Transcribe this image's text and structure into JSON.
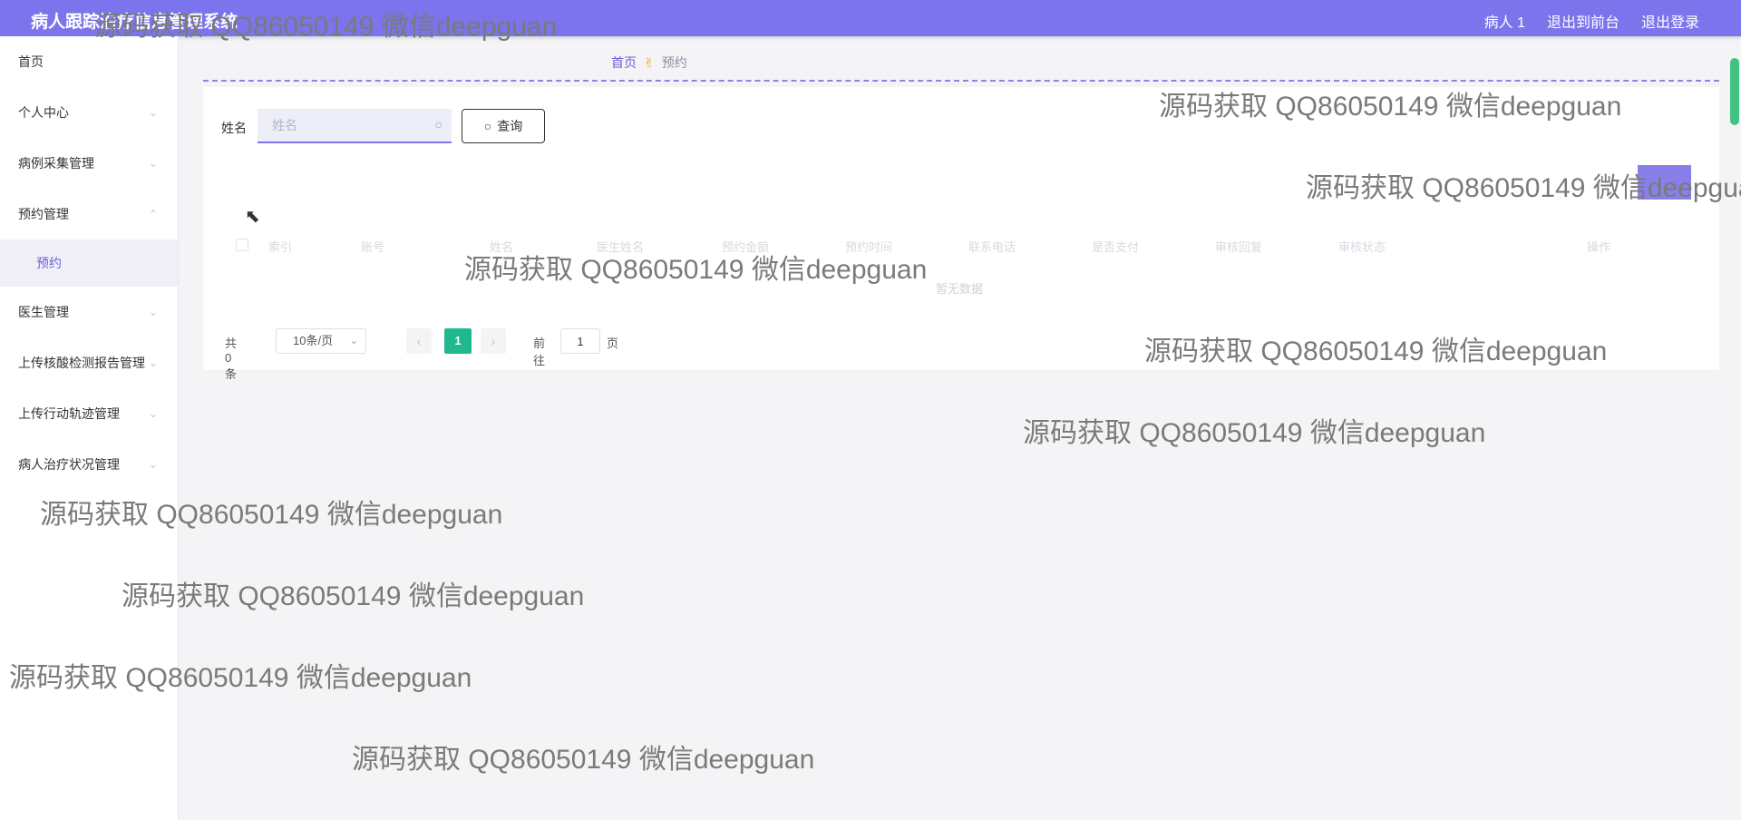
{
  "header": {
    "title": "病人跟踪治疗信息管理系统",
    "links": [
      "病人 1",
      "退出到前台",
      "退出登录"
    ]
  },
  "sidebar": {
    "items": [
      {
        "label": "首页",
        "chevron": ""
      },
      {
        "label": "个人中心",
        "chevron": "⌄"
      },
      {
        "label": "病例采集管理",
        "chevron": "⌄"
      },
      {
        "label": "预约管理",
        "chevron": "⌃"
      },
      {
        "label": "预约",
        "chevron": ""
      },
      {
        "label": "医生管理",
        "chevron": "⌄"
      },
      {
        "label": "上传核酸检测报告管理",
        "chevron": "⌄"
      },
      {
        "label": "上传行动轨迹管理",
        "chevron": "⌄"
      },
      {
        "label": "病人治疗状况管理",
        "chevron": "⌄"
      }
    ]
  },
  "breadcrumb": {
    "home": "首页",
    "current": "预约"
  },
  "search": {
    "label": "姓名",
    "placeholder": "姓名",
    "button": "查询"
  },
  "table": {
    "columns": [
      "索引",
      "账号",
      "姓名",
      "医生姓名",
      "预约金额",
      "预约时间",
      "联系电话",
      "是否支付",
      "审核回复",
      "审核状态",
      "操作"
    ],
    "empty_text": "暂无数据"
  },
  "pagination": {
    "total": "共 0 条",
    "page_size": "10条/页",
    "current_page": "1",
    "goto_label": "前往",
    "goto_value": "1",
    "page_unit": "页"
  },
  "watermark": {
    "text": "源码获取 QQ86050149 微信deepguan"
  },
  "colors": {
    "accent": "#7b74ec",
    "page_active": "#1fb88f"
  }
}
